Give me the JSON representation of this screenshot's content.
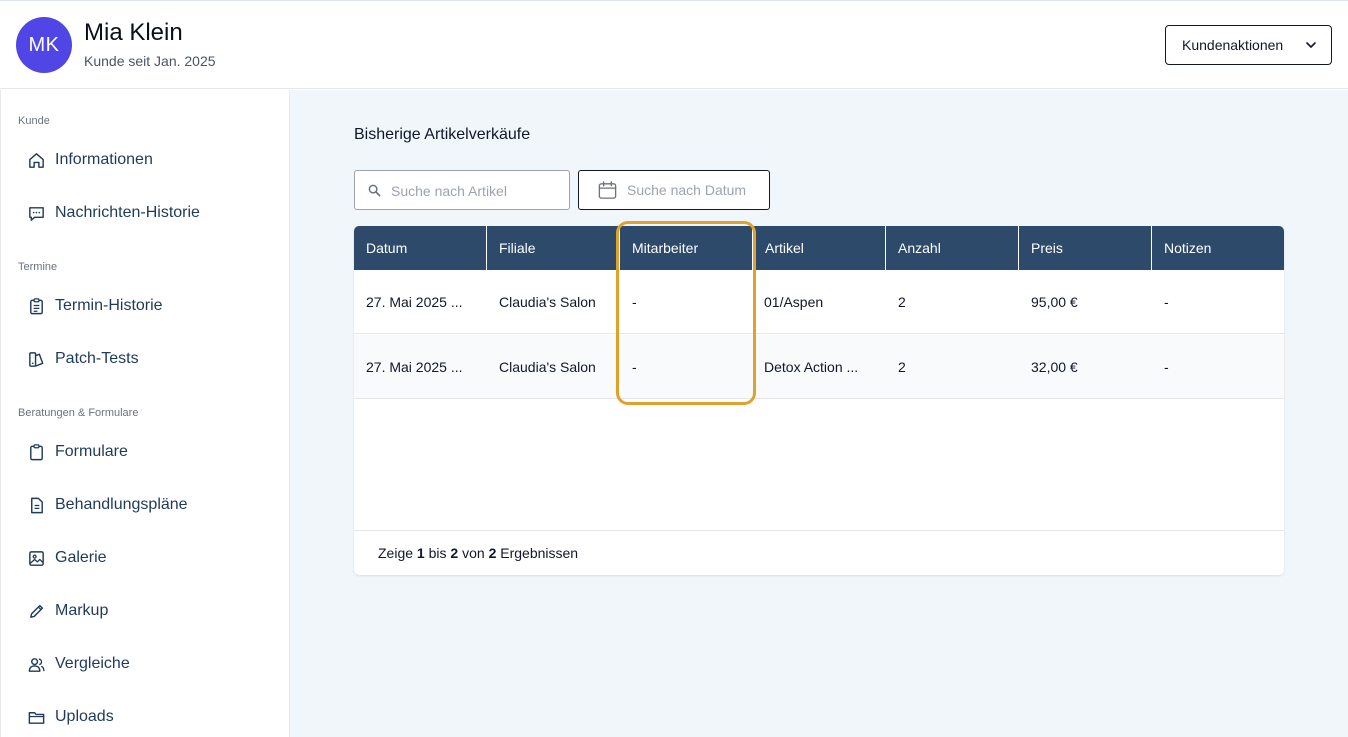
{
  "customer": {
    "initials": "MK",
    "name": "Mia Klein",
    "since": "Kunde seit Jan. 2025",
    "avatar_color": "#4f46e5"
  },
  "header": {
    "actions_label": "Kundenaktionen"
  },
  "sidebar": {
    "sections": [
      {
        "label": "Kunde",
        "items": [
          {
            "label": "Informationen",
            "icon": "home-icon"
          },
          {
            "label": "Nachrichten-Historie",
            "icon": "chat-icon"
          }
        ]
      },
      {
        "label": "Termine",
        "items": [
          {
            "label": "Termin-Historie",
            "icon": "clipboard-list-icon"
          },
          {
            "label": "Patch-Tests",
            "icon": "swatch-icon"
          }
        ]
      },
      {
        "label": "Beratungen & Formulare",
        "items": [
          {
            "label": "Formulare",
            "icon": "clipboard-icon"
          },
          {
            "label": "Behandlungspläne",
            "icon": "document-icon"
          },
          {
            "label": "Galerie",
            "icon": "image-icon"
          },
          {
            "label": "Markup",
            "icon": "pencil-icon"
          },
          {
            "label": "Vergleiche",
            "icon": "users-icon"
          },
          {
            "label": "Uploads",
            "icon": "folder-icon"
          }
        ]
      }
    ]
  },
  "main": {
    "title": "Bisherige Artikelverkäufe",
    "search_placeholder": "Suche nach Artikel",
    "date_placeholder": "Suche nach Datum",
    "table": {
      "columns": [
        "Datum",
        "Filiale",
        "Mitarbeiter",
        "Artikel",
        "Anzahl",
        "Preis",
        "Notizen"
      ],
      "rows": [
        [
          "27. Mai 2025 ...",
          "Claudia's Salon",
          "-",
          "01/Aspen",
          "2",
          "95,00 €",
          "-"
        ],
        [
          "27. Mai 2025 ...",
          "Claudia's Salon",
          "-",
          "Detox Action ...",
          "2",
          "32,00 €",
          "-"
        ]
      ],
      "footer": {
        "prefix": "Zeige",
        "from": "1",
        "mid1": "bis",
        "to": "2",
        "mid2": "von",
        "total": "2",
        "suffix": "Ergebnissen"
      }
    }
  },
  "colors": {
    "table_header": "#2d4a6b",
    "highlight": "#e0a22d",
    "main_bg": "#f1f6fb"
  }
}
